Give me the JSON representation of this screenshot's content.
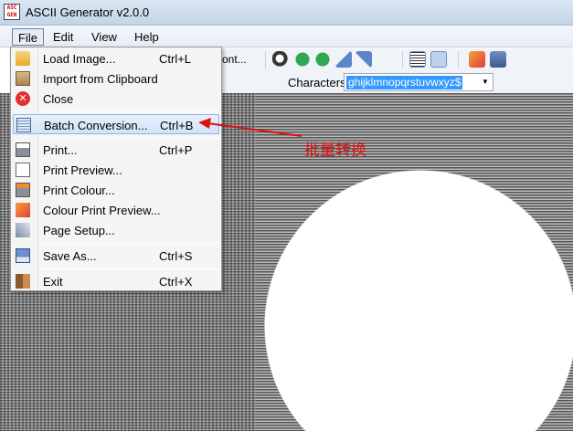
{
  "window": {
    "title": "ASCII Generator v2.0.0",
    "icon_text": "ASC GEN"
  },
  "menubar": {
    "items": [
      "File",
      "Edit",
      "View",
      "Help"
    ]
  },
  "toolbar": {
    "font_label": "ont..."
  },
  "characters": {
    "label": "Characters:",
    "value": "ghijklmnopqrstuvwxyz$"
  },
  "file_menu": {
    "items": [
      {
        "label": "Load Image...",
        "shortcut": "Ctrl+L",
        "icon": "folder-open-icon"
      },
      {
        "label": "Import from Clipboard",
        "shortcut": "",
        "icon": "clipboard-icon"
      },
      {
        "label": "Close",
        "shortcut": "",
        "icon": "close-icon"
      },
      {
        "label": "Batch Conversion...",
        "shortcut": "Ctrl+B",
        "icon": "batch-icon"
      },
      {
        "label": "Print...",
        "shortcut": "Ctrl+P",
        "icon": "printer-icon"
      },
      {
        "label": "Print Preview...",
        "shortcut": "",
        "icon": "print-preview-icon"
      },
      {
        "label": "Print Colour...",
        "shortcut": "",
        "icon": "print-colour-icon"
      },
      {
        "label": "Colour Print Preview...",
        "shortcut": "",
        "icon": "colour-preview-icon"
      },
      {
        "label": "Page Setup...",
        "shortcut": "",
        "icon": "page-setup-icon"
      },
      {
        "label": "Save As...",
        "shortcut": "Ctrl+S",
        "icon": "save-icon"
      },
      {
        "label": "Exit",
        "shortcut": "Ctrl+X",
        "icon": "exit-icon"
      }
    ]
  },
  "annotation": {
    "text": "批量转换",
    "color": "#dd1111"
  }
}
